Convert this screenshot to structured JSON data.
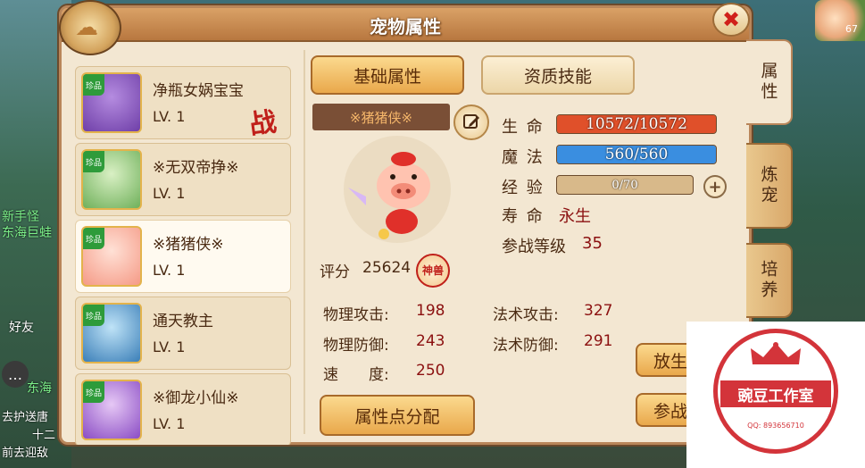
{
  "window": {
    "title": "宠物属性"
  },
  "background": {
    "labels": [
      "新手怪",
      "东海巨蛙",
      "好友",
      "东海",
      "去护送唐",
      "前去迎敌",
      "十二"
    ],
    "level": "67"
  },
  "pets": [
    {
      "name": "净瓶女娲宝宝",
      "level": "LV. 1",
      "badge": "珍品",
      "battle": "战",
      "colors": [
        "#b58ce0",
        "#6f3fa8"
      ]
    },
    {
      "name": "※无双帝挣※",
      "level": "LV. 1",
      "badge": "珍品",
      "battle": "",
      "colors": [
        "#d9f0c4",
        "#6fb05a"
      ]
    },
    {
      "name": "※猪猪侠※",
      "level": "LV. 1",
      "badge": "珍品",
      "battle": "",
      "colors": [
        "#ffe1d6",
        "#f59a86"
      ],
      "selected": true
    },
    {
      "name": "通天教主",
      "level": "LV. 1",
      "badge": "珍品",
      "battle": "",
      "colors": [
        "#bfe3f7",
        "#3b7fb8"
      ]
    },
    {
      "name": "※御龙小仙※",
      "level": "LV. 1",
      "badge": "珍品",
      "battle": "",
      "colors": [
        "#e6c8f5",
        "#8a4cc4"
      ]
    }
  ],
  "tabs": {
    "basic": "基础属性",
    "aptitude": "资质技能"
  },
  "side_tabs": [
    "属性",
    "炼宠",
    "培养"
  ],
  "selected_pet": {
    "name": "※猪猪侠※",
    "score_label": "评分",
    "score": "25624",
    "rank": "神兽"
  },
  "vitals": {
    "hp_label": "生 命",
    "hp": "10572/10572",
    "hp_fraction": 1.0,
    "mp_label": "魔 法",
    "mp": "560/560",
    "mp_fraction": 1.0,
    "exp_label": "经 验",
    "exp": "0/70",
    "exp_fraction": 0.0,
    "life_label": "寿 命",
    "life": "永生",
    "battle_level_label": "参战等级",
    "battle_level": "35"
  },
  "attributes": {
    "phys_atk_label": "物理攻击:",
    "phys_atk": "198",
    "mag_atk_label": "法术攻击:",
    "mag_atk": "327",
    "phys_def_label": "物理防御:",
    "phys_def": "243",
    "mag_def_label": "法术防御:",
    "mag_def": "291",
    "speed_label": "速　　度:",
    "speed": "250"
  },
  "buttons": {
    "assign_points": "属性点分配",
    "release": "放生",
    "battle": "参战"
  },
  "watermark": {
    "title": "豌豆工作室",
    "qq": "QQ: 893656710"
  },
  "colors": {
    "hp_bar": "#e0502a",
    "mp_bar": "#3a8ee0",
    "exp_bar": "#d8b98a",
    "accent": "#c0201a"
  }
}
